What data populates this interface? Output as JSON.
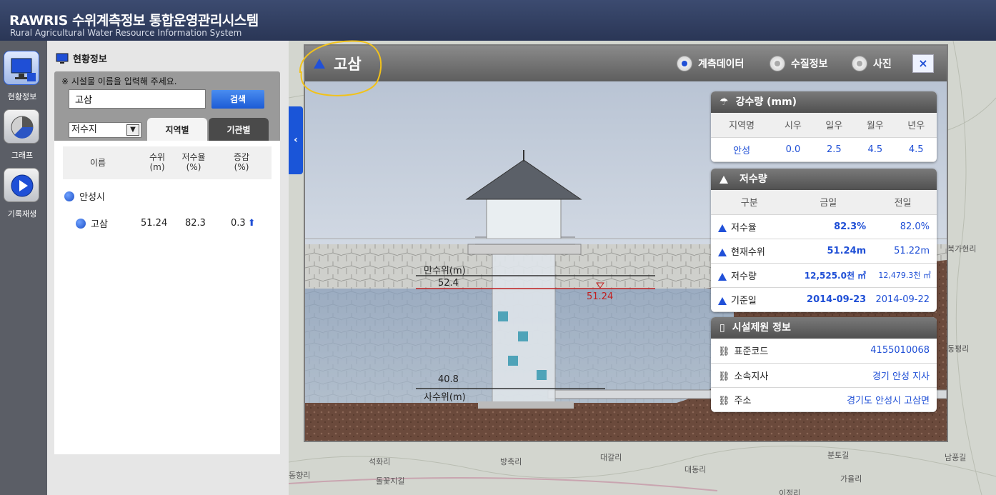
{
  "header": {
    "title": "RAWRIS 수위계측정보 통합운영관리시스템",
    "subtitle": "Rural Agricultural Water Resource Information System"
  },
  "rail": {
    "items": [
      {
        "label": "현황정보"
      },
      {
        "label": "그래프"
      },
      {
        "label": "기록재생"
      }
    ]
  },
  "panel": {
    "title": "현황정보",
    "hint": "※ 시설물 이름을 입력해 주세요.",
    "search_value": "고삼",
    "search_button": "검색",
    "select_value": "저수지",
    "tabs": [
      {
        "label": "지역별"
      },
      {
        "label": "기관별"
      }
    ],
    "columns": {
      "name": "이름",
      "level": "수위\n(m)",
      "rate": "저수율\n(%)",
      "change": "증감\n(%)"
    },
    "group": "안성시",
    "row": {
      "name": "고삼",
      "level": "51.24",
      "rate": "82.3",
      "change": "0.3"
    }
  },
  "map_labels": [
    "석화리",
    "방축리",
    "대갈리",
    "분토길",
    "남풍길",
    "돌꽃지길",
    "대동리",
    "가율리",
    "동향리",
    "이정리",
    "북가현리",
    "동평리"
  ],
  "popup": {
    "title": "고삼",
    "radios": [
      {
        "label": "계측데이터",
        "selected": true
      },
      {
        "label": "수질정보",
        "selected": false
      },
      {
        "label": "사진",
        "selected": false
      }
    ],
    "close": "×",
    "scene": {
      "full_label": "만수위(m)",
      "full_value": "52.4",
      "current_value": "51.24",
      "dead_value": "40.8",
      "dead_label": "사수위(m)"
    },
    "rainfall": {
      "title": "강수량 (mm)",
      "headers": [
        "지역명",
        "시우",
        "일우",
        "월우",
        "년우"
      ],
      "row": [
        "안성",
        "0.0",
        "2.5",
        "4.5",
        "4.5"
      ]
    },
    "storage": {
      "title": "저수량",
      "headers": [
        "구분",
        "금일",
        "전일"
      ],
      "rows": [
        [
          "저수율",
          "82.3%",
          "82.0%"
        ],
        [
          "현재수위",
          "51.24m",
          "51.22m"
        ],
        [
          "저수량",
          "12,525.0천 ㎥",
          "12,479.3천 ㎥"
        ],
        [
          "기준일",
          "2014-09-23",
          "2014-09-22"
        ]
      ]
    },
    "facility": {
      "title": "시설제원 정보",
      "rows": [
        [
          "표준코드",
          "4155010068"
        ],
        [
          "소속지사",
          "경기 안성 지사"
        ],
        [
          "주소",
          "경기도 안성시 고삼면"
        ]
      ]
    }
  },
  "colors": {
    "accent": "#1f4fd6",
    "header": "#2f3b5e",
    "highlight_circle": "#f2c21a"
  }
}
